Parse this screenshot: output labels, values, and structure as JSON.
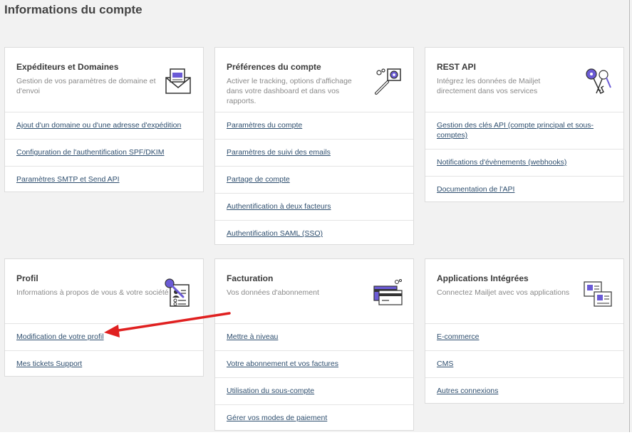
{
  "page": {
    "title": "Informations du compte"
  },
  "cards": {
    "senders": {
      "title": "Expéditeurs et Domaines",
      "desc": "Gestion de vos paramètres de domaine et d'envoi",
      "icon": "envelope-icon",
      "links": [
        "Ajout d'un domaine ou d'une adresse d'expédition",
        "Configuration de l'authentification SPF/DKIM",
        "Paramètres SMTP et Send API"
      ]
    },
    "preferences": {
      "title": "Préférences du compte",
      "desc": "Activer le tracking, options d'affichage dans votre dashboard et dans vos rapports.",
      "icon": "wrench-gear-icon",
      "links": [
        "Paramètres du compte",
        "Paramètres de suivi des emails",
        "Partage de compte",
        "Authentification à deux facteurs",
        "Authentification SAML (SSO)"
      ]
    },
    "rest_api": {
      "title": "REST API",
      "desc": "Intégrez les données de Mailjet directement dans vos services",
      "icon": "keys-icon",
      "links": [
        "Gestion des clés API (compte principal et sous-comptes)",
        "Notifications d'évènements (webhooks)",
        "Documentation de l'API"
      ]
    },
    "profile": {
      "title": "Profil",
      "desc": "Informations à propos de vous & votre société",
      "icon": "profile-card-icon",
      "links": [
        "Modification de votre profil",
        "Mes tickets Support"
      ]
    },
    "billing": {
      "title": "Facturation",
      "desc": "Vos données d'abonnement",
      "icon": "credit-card-icon",
      "links": [
        "Mettre à niveau",
        "Votre abonnement et vos factures",
        "Utilisation du sous-compte",
        "Gérer vos modes de paiement"
      ]
    },
    "integrations": {
      "title": "Applications Intégrées",
      "desc": "Connectez Mailjet avec vos applications",
      "icon": "app-windows-icon",
      "links": [
        "E-commerce",
        "CMS",
        "Autres connexions"
      ]
    }
  },
  "colors": {
    "link": "#2f4f6f",
    "icon_accent": "#6b5bd6",
    "annotation_arrow": "#e02020"
  }
}
